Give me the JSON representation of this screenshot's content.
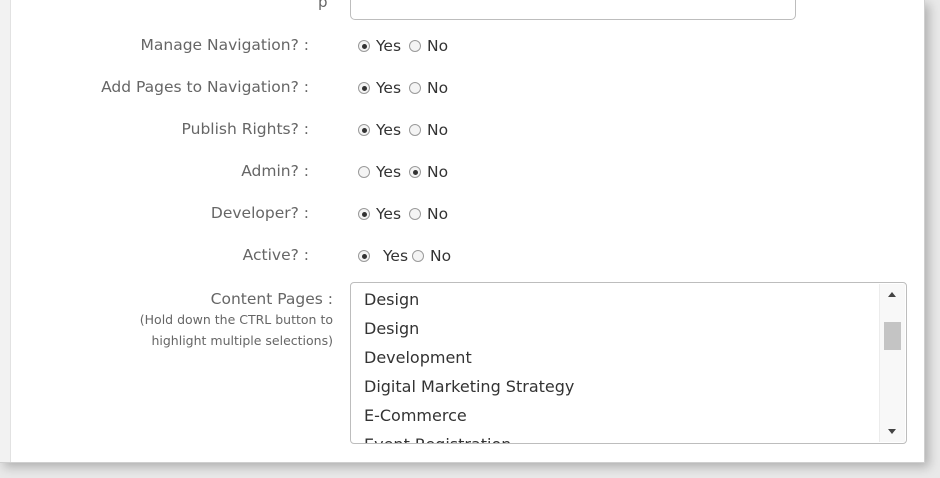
{
  "form": {
    "top_label_fragment": "p",
    "rows": [
      {
        "label": "Manage Navigation? :",
        "yes": "Yes",
        "no": "No",
        "selected": "yes"
      },
      {
        "label": "Add Pages to Navigation? :",
        "yes": "Yes",
        "no": "No",
        "selected": "yes"
      },
      {
        "label": "Publish Rights? :",
        "yes": "Yes",
        "no": "No",
        "selected": "yes"
      },
      {
        "label": "Admin? :",
        "yes": "Yes",
        "no": "No",
        "selected": "no"
      },
      {
        "label": "Developer? :",
        "yes": "Yes",
        "no": "No",
        "selected": "yes"
      },
      {
        "label": "Active? :",
        "yes": "Yes",
        "no": "No",
        "selected": "yes"
      }
    ],
    "content_pages": {
      "label": "Content Pages :",
      "hint_line1": "(Hold down the CTRL button to",
      "hint_line2": "highlight multiple selections)",
      "options": [
        "Design",
        "Design",
        "Development",
        "Digital Marketing Strategy",
        "E-Commerce",
        "Event Registration"
      ]
    }
  }
}
